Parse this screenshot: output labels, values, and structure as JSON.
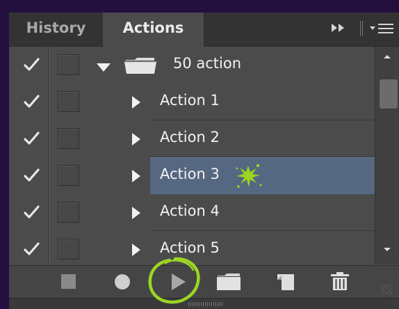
{
  "tabs": [
    {
      "label": "History",
      "active": false
    },
    {
      "label": "Actions",
      "active": true
    }
  ],
  "panel_icons": {
    "expand": "double-arrow-icon",
    "menu": "panel-menu-icon"
  },
  "actions": {
    "set": {
      "label": "50 action",
      "expanded": true,
      "checked": true
    },
    "items": [
      {
        "label": "Action 1",
        "checked": true,
        "selected": false
      },
      {
        "label": "Action 2",
        "checked": true,
        "selected": false
      },
      {
        "label": "Action 3",
        "checked": true,
        "selected": true
      },
      {
        "label": "Action 4",
        "checked": true,
        "selected": false
      },
      {
        "label": "Action 5",
        "checked": true,
        "selected": false
      }
    ]
  },
  "toolbar": {
    "buttons": [
      "stop-icon",
      "record-icon",
      "play-icon",
      "folder-icon",
      "new-action-icon",
      "trash-icon"
    ]
  },
  "colors": {
    "background": "#24103f",
    "panel": "#4b4b4b",
    "selection": "#566781",
    "highlight_annotation": "#9bd623"
  }
}
